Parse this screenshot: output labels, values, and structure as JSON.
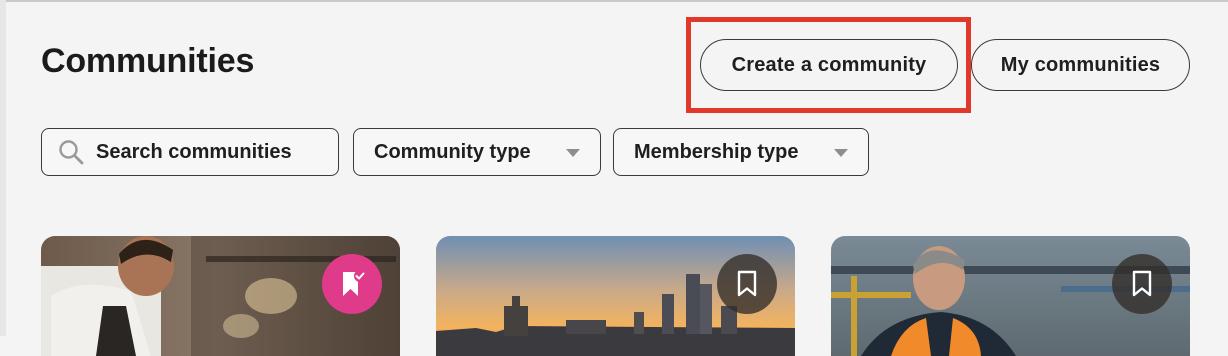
{
  "header": {
    "title": "Communities",
    "create_button_label": "Create a community",
    "my_communities_button_label": "My communities"
  },
  "filters": {
    "search_label": "Search communities",
    "community_type_label": "Community type",
    "membership_type_label": "Membership type"
  },
  "cards": [
    {
      "image_subject": "chef in kitchen",
      "bookmark_state": "saved",
      "bookmark_icon": "bookmark-check-icon"
    },
    {
      "image_subject": "London skyline at sunset",
      "bookmark_state": "unsaved",
      "bookmark_icon": "bookmark-icon"
    },
    {
      "image_subject": "worker in high-visibility jacket",
      "bookmark_state": "unsaved",
      "bookmark_icon": "bookmark-icon"
    }
  ],
  "colors": {
    "background": "#f4f4f4",
    "highlight": "#e0392b",
    "saved_badge": "#e03a8a",
    "text": "#1f1f1f"
  }
}
